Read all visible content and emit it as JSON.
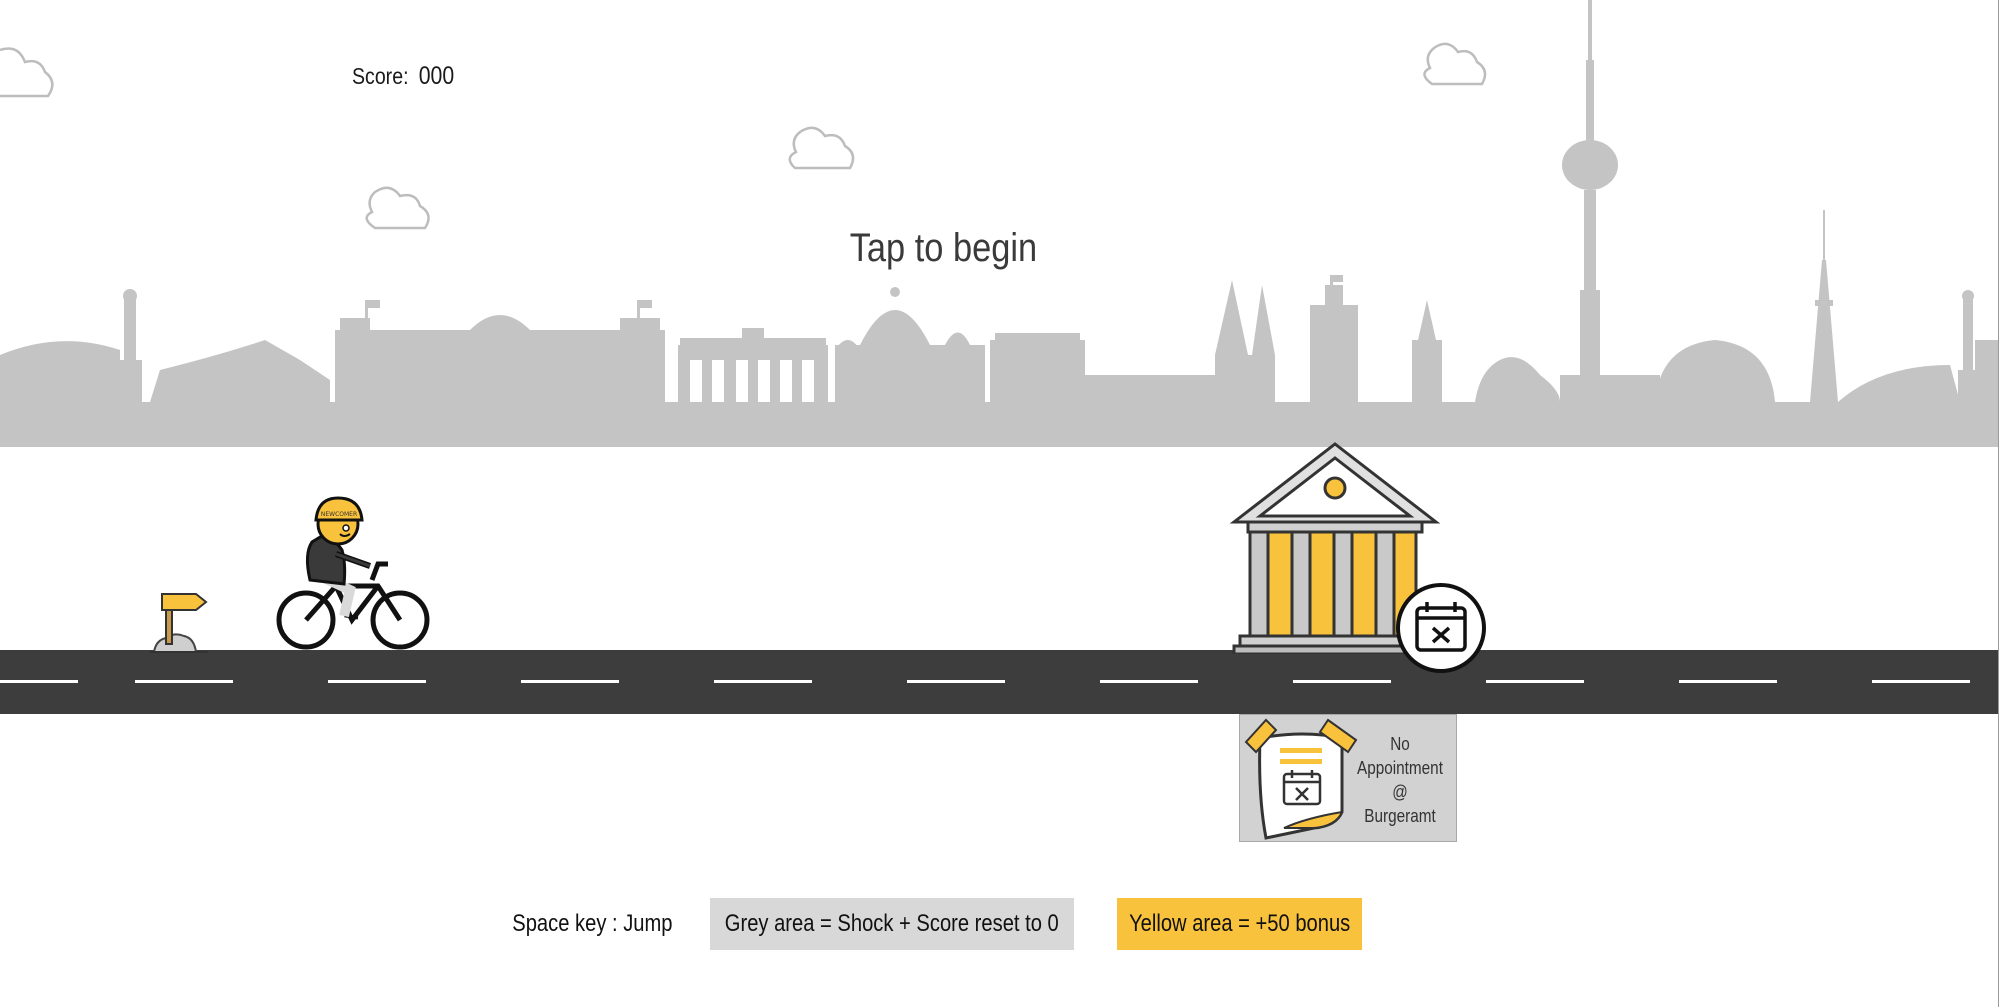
{
  "score": {
    "label": "Score:",
    "value": "000"
  },
  "prompt": "Tap to begin",
  "colors": {
    "skyline": "#c4c4c4",
    "road": "#3d3d3d",
    "accent_yellow": "#f9c23c",
    "grey_area": "#d8d8d8"
  },
  "player": {
    "helmet_text": "NEWCOMER",
    "icon": "cyclist-icon"
  },
  "obstacle": {
    "icon": "government-building-icon",
    "badge_icon": "calendar-x-icon"
  },
  "sign": {
    "lines": [
      "No",
      "Appointment",
      "@",
      "Burgeramt"
    ],
    "icon": "calendar-note-icon"
  },
  "legend": {
    "jump": "Space key : Jump",
    "grey": "Grey area = Shock + Score reset to 0",
    "yellow": "Yellow area = +50 bonus"
  }
}
